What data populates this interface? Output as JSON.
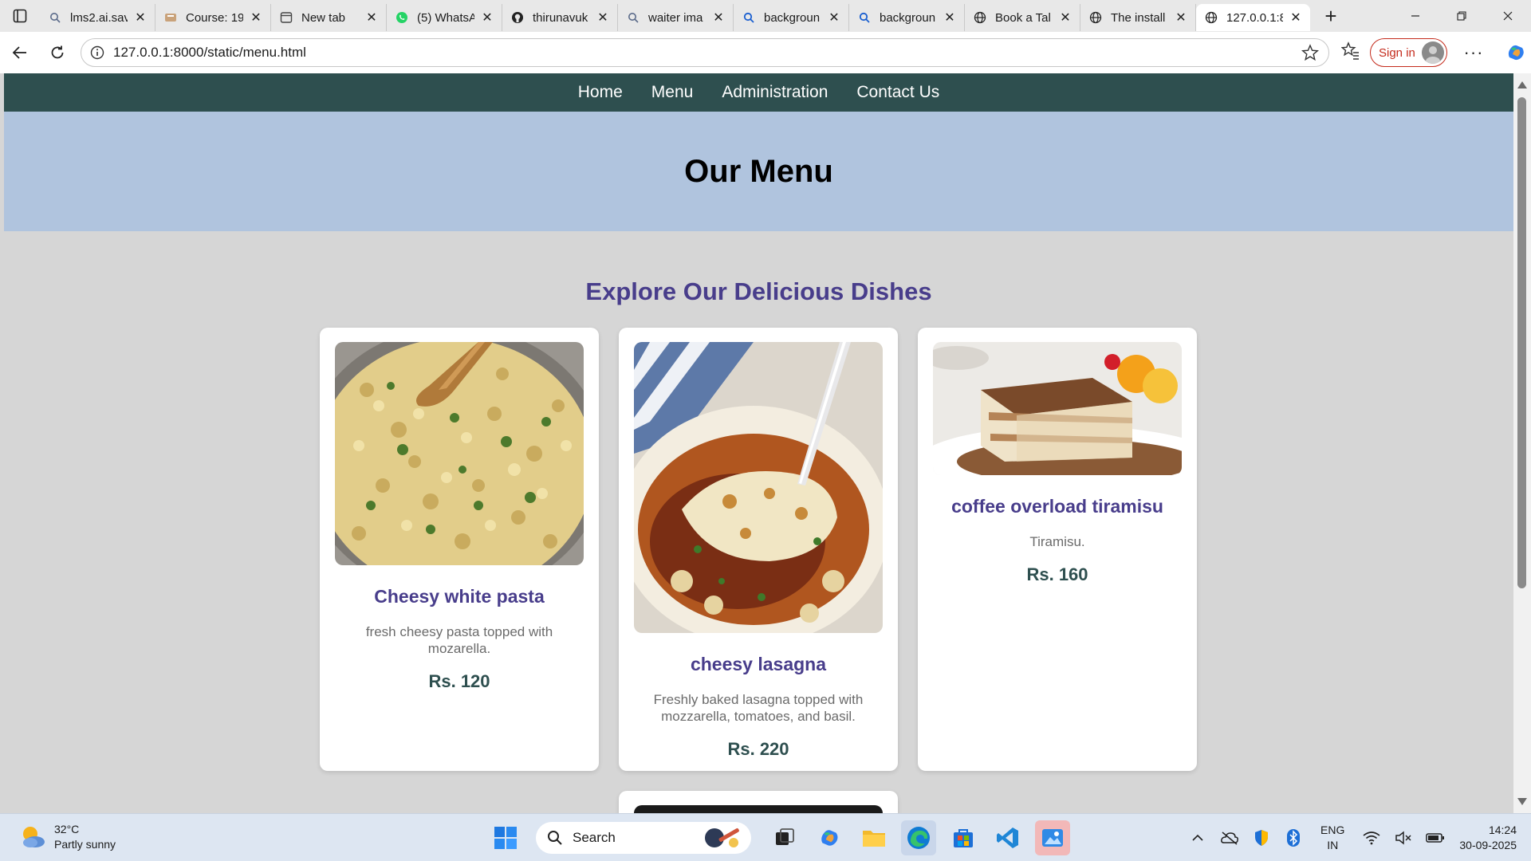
{
  "browser": {
    "tabs": [
      {
        "title": "lms2.ai.sav",
        "icon": "search-icon"
      },
      {
        "title": "Course: 19",
        "icon": "course-icon"
      },
      {
        "title": "New tab",
        "icon": "newtab-icon"
      },
      {
        "title": "(5) WhatsA",
        "icon": "whatsapp-icon"
      },
      {
        "title": "thirunavuk",
        "icon": "github-icon"
      },
      {
        "title": "waiter ima",
        "icon": "search-icon"
      },
      {
        "title": "backgroun",
        "icon": "search-icon"
      },
      {
        "title": "backgroun",
        "icon": "search-icon"
      },
      {
        "title": "Book a Tal",
        "icon": "globe-icon"
      },
      {
        "title": "The install",
        "icon": "globe-icon"
      },
      {
        "title": "127.0.0.1:8",
        "icon": "globe-icon",
        "active": true
      }
    ],
    "url": "127.0.0.1:8000/static/menu.html",
    "signin_label": "Sign in"
  },
  "site": {
    "nav": [
      "Home",
      "Menu",
      "Administration",
      "Contact Us"
    ],
    "hero_title": "Our Menu",
    "section_title": "Explore Our Delicious Dishes",
    "dishes": [
      {
        "name": "Cheesy white pasta",
        "description": "fresh cheesy pasta topped with mozarella.",
        "price": "Rs. 120"
      },
      {
        "name": "cheesy lasagna",
        "description": "Freshly baked lasagna topped with mozzarella, tomatoes, and basil.",
        "price": "Rs. 220"
      },
      {
        "name": "coffee overload tiramisu",
        "description": "Tiramisu.",
        "price": "Rs. 160"
      }
    ],
    "colors": {
      "nav_bg": "#2e4f4f",
      "hero_bg": "#b0c4de",
      "accent": "#483d8b",
      "page_bg": "#d6d6d6"
    }
  },
  "taskbar": {
    "weather_temp": "32°C",
    "weather_desc": "Partly sunny",
    "search_label": "Search",
    "lang_top": "ENG",
    "lang_bottom": "IN",
    "time": "14:24",
    "date": "30-09-2025"
  }
}
